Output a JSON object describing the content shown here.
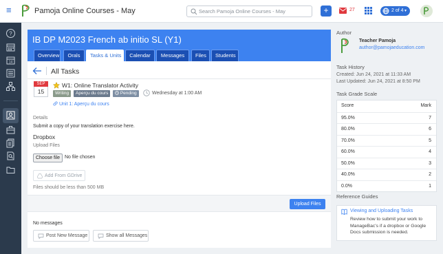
{
  "app": {
    "title": "Pamoja Online Courses - May"
  },
  "search": {
    "placeholder": "Search Pamoja Online Courses - May"
  },
  "topbar": {
    "add_label": "+",
    "mail_count": "27",
    "pager_label": "2 of 4"
  },
  "course": {
    "title": "IB DP M2023 French ab initio SL (Y1)",
    "tabs": [
      {
        "label": "Overview"
      },
      {
        "label": "Orals"
      },
      {
        "label": "Tasks & Units",
        "active": true
      },
      {
        "label": "Calendar"
      },
      {
        "label": "Messages"
      },
      {
        "label": "Files"
      },
      {
        "label": "Students"
      }
    ]
  },
  "page": {
    "heading": "All Tasks"
  },
  "task": {
    "month": "SEP",
    "day": "15",
    "title": "W1: Online Translator Activity",
    "badges": [
      "Writing",
      "Aperçu du cours",
      "Pending"
    ],
    "due": "Wednesday at 1:00 AM",
    "unit": "Unit 1: Aperçu du cours",
    "details_label": "Details",
    "details_text": "Submit a copy of your translation exercise here.",
    "dropbox_label": "Dropbox",
    "upload_label": "Upload Files",
    "choose_file": "Choose file",
    "no_file": "No file chosen",
    "gdrive_label": "Add From GDrive",
    "size_note": "Files should be less than 500 MB",
    "upload_button": "Upload Files"
  },
  "messages": {
    "empty": "No messages",
    "post_button": "Post New Message",
    "show_button": "Show all Messages"
  },
  "sidebar_right": {
    "author_heading": "Author",
    "author_name": "Teacher Pamoja",
    "author_email": "author@pamojaeducation.com",
    "history_heading": "Task History",
    "created": "Created: Jun 24, 2021 at 11:33 AM",
    "updated": "Last Updated: Jun 24, 2021 at 8:50 PM",
    "grade_heading": "Task Grade Scale",
    "grade_header": {
      "score": "Score",
      "mark": "Mark"
    },
    "grades": [
      {
        "score": "95.0%",
        "mark": "7"
      },
      {
        "score": "80.0%",
        "mark": "6"
      },
      {
        "score": "70.0%",
        "mark": "5"
      },
      {
        "score": "60.0%",
        "mark": "4"
      },
      {
        "score": "50.0%",
        "mark": "3"
      },
      {
        "score": "40.0%",
        "mark": "2"
      },
      {
        "score": "0.0%",
        "mark": "1"
      }
    ],
    "ref_heading": "Reference Guides",
    "ref_link": "Viewing and Uploading Tasks",
    "ref_desc": "Review how to submit your work to ManageBac's if a dropbox or Google Docs submission is needed."
  },
  "colors": {
    "accent": "#3d82f0",
    "sidebar": "#2b3a4c",
    "calendar_red": "#e0393e"
  }
}
